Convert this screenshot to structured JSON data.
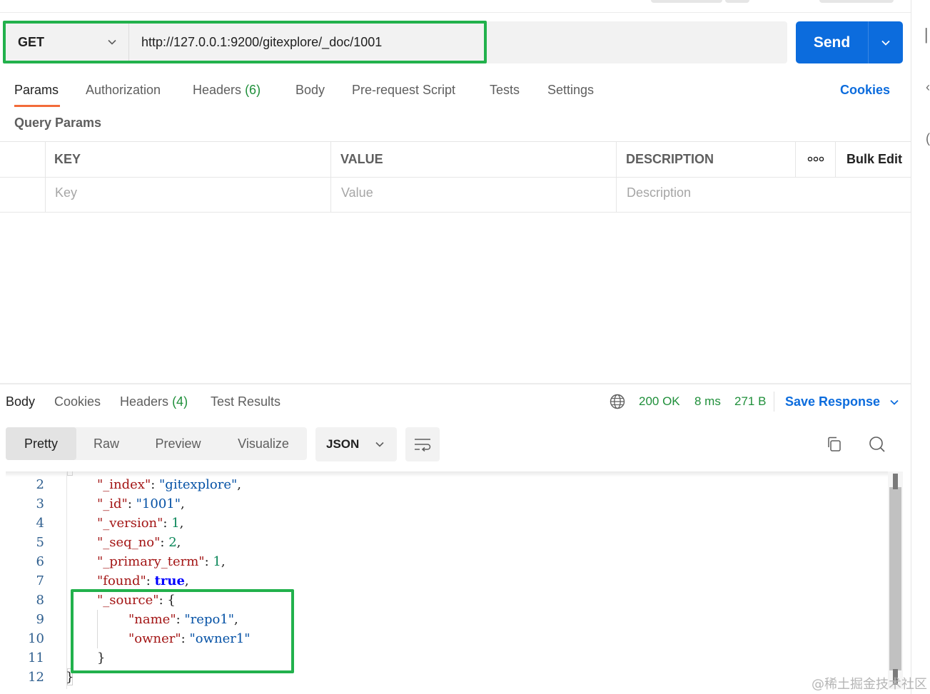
{
  "request": {
    "method": "GET",
    "url": "http://127.0.0.1:9200/gitexplore/_doc/1001",
    "send_label": "Send"
  },
  "request_tabs": {
    "params": "Params",
    "authorization": "Authorization",
    "headers": "Headers",
    "headers_count": "(6)",
    "body": "Body",
    "pre_request": "Pre-request Script",
    "tests": "Tests",
    "settings": "Settings",
    "cookies": "Cookies"
  },
  "query_params": {
    "title": "Query Params",
    "columns": {
      "key": "KEY",
      "value": "VALUE",
      "description": "DESCRIPTION"
    },
    "bulk_edit": "Bulk Edit",
    "placeholders": {
      "key": "Key",
      "value": "Value",
      "description": "Description"
    }
  },
  "response_tabs": {
    "body": "Body",
    "cookies": "Cookies",
    "headers": "Headers",
    "headers_count": "(4)",
    "test_results": "Test Results"
  },
  "response_meta": {
    "status": "200 OK",
    "time": "8 ms",
    "size": "271 B",
    "save_response": "Save Response"
  },
  "view_modes": {
    "pretty": "Pretty",
    "raw": "Raw",
    "preview": "Preview",
    "visualize": "Visualize",
    "format": "JSON"
  },
  "code": {
    "line_numbers": [
      "2",
      "3",
      "4",
      "5",
      "6",
      "7",
      "8",
      "9",
      "10",
      "11",
      "12"
    ],
    "lines": [
      [
        [
          "k",
          "\"_index\""
        ],
        [
          "p",
          ": "
        ],
        [
          "s",
          "\"gitexplore\""
        ],
        [
          "p",
          ","
        ]
      ],
      [
        [
          "k",
          "\"_id\""
        ],
        [
          "p",
          ": "
        ],
        [
          "s",
          "\"1001\""
        ],
        [
          "p",
          ","
        ]
      ],
      [
        [
          "k",
          "\"_version\""
        ],
        [
          "p",
          ": "
        ],
        [
          "n",
          "1"
        ],
        [
          "p",
          ","
        ]
      ],
      [
        [
          "k",
          "\"_seq_no\""
        ],
        [
          "p",
          ": "
        ],
        [
          "n",
          "2"
        ],
        [
          "p",
          ","
        ]
      ],
      [
        [
          "k",
          "\"_primary_term\""
        ],
        [
          "p",
          ": "
        ],
        [
          "n",
          "1"
        ],
        [
          "p",
          ","
        ]
      ],
      [
        [
          "k",
          "\"found\""
        ],
        [
          "p",
          ": "
        ],
        [
          "b",
          "true"
        ],
        [
          "p",
          ","
        ]
      ],
      [
        [
          "k",
          "\"_source\""
        ],
        [
          "p",
          ": {"
        ]
      ],
      [
        [
          "k",
          "\"name\""
        ],
        [
          "p",
          ": "
        ],
        [
          "s",
          "\"repo1\""
        ],
        [
          "p",
          ","
        ]
      ],
      [
        [
          "k",
          "\"owner\""
        ],
        [
          "p",
          ": "
        ],
        [
          "s",
          "\"owner1\""
        ]
      ],
      [
        [
          "p",
          "}"
        ]
      ],
      [
        [
          "p",
          "}"
        ]
      ]
    ],
    "indents": [
      1,
      1,
      1,
      1,
      1,
      1,
      1,
      2,
      2,
      1,
      0
    ]
  },
  "watermark": "@稀土掘金技术社区",
  "colors": {
    "accent": "#0c6cdd",
    "highlight": "#22b14c",
    "status_ok": "#1f8f3a",
    "active_tab_underline": "#f26b3a"
  }
}
